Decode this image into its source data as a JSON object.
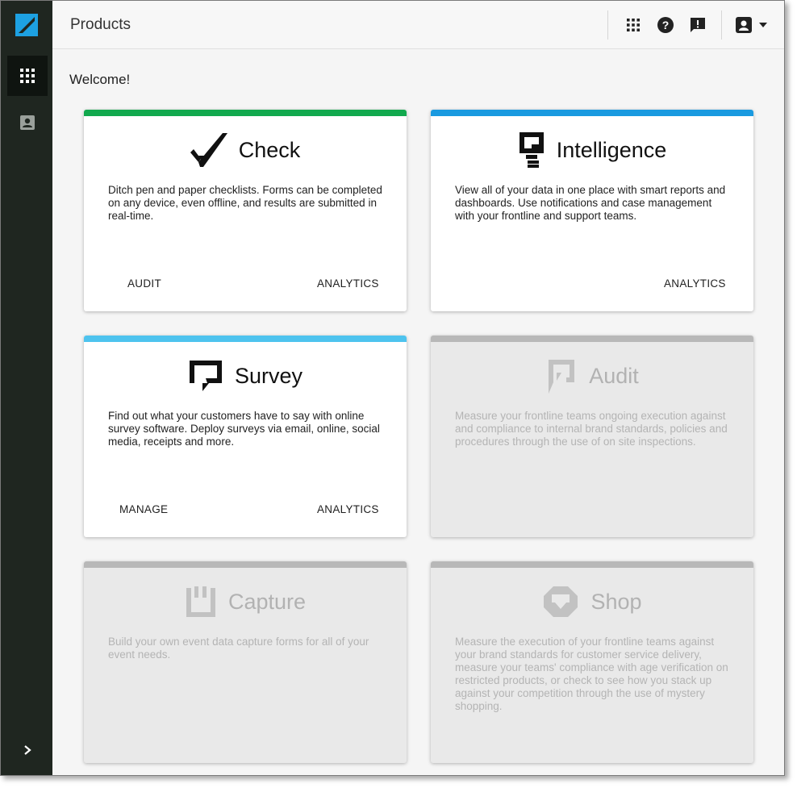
{
  "header": {
    "title": "Products"
  },
  "welcome": "Welcome!",
  "sidebar": {
    "items": [
      {
        "icon": "apps-grid-icon",
        "active": true
      },
      {
        "icon": "contact-card-icon",
        "active": false
      }
    ],
    "expand_icon": "chevron-right-icon"
  },
  "header_icons": [
    "apps-grid-icon",
    "help-icon",
    "feedback-icon",
    "account-icon",
    "caret-down-icon"
  ],
  "products": [
    {
      "name": "Check",
      "accent": "#12a94e",
      "icon": "check-logo-icon",
      "enabled": true,
      "description": "Ditch pen and paper checklists. Forms can be completed on any device, even offline, and results are submitted in real-time.",
      "actions": [
        "AUDIT",
        "ANALYTICS"
      ]
    },
    {
      "name": "Intelligence",
      "accent": "#1a9ae0",
      "icon": "intelligence-logo-icon",
      "enabled": true,
      "description": "View all of your data in one place with smart reports and dashboards. Use notifications and case management with your frontline and support teams.",
      "actions": [
        "ANALYTICS"
      ]
    },
    {
      "name": "Survey",
      "accent": "#4ec3ee",
      "icon": "survey-logo-icon",
      "enabled": true,
      "description": "Find out what your customers have to say with online survey software. Deploy surveys via email, online, social media, receipts and more.",
      "actions": [
        "MANAGE",
        "ANALYTICS"
      ]
    },
    {
      "name": "Audit",
      "accent": "#b8b8b8",
      "icon": "audit-logo-icon",
      "enabled": false,
      "description": "Measure your frontline teams ongoing execution against and compliance to internal brand standards, policies and procedures through the use of on site inspections.",
      "actions": []
    },
    {
      "name": "Capture",
      "accent": "#b8b8b8",
      "icon": "capture-logo-icon",
      "enabled": false,
      "description": "Build your own event data capture forms for all of your event needs.",
      "actions": []
    },
    {
      "name": "Shop",
      "accent": "#b8b8b8",
      "icon": "shop-logo-icon",
      "enabled": false,
      "description": "Measure the execution of your frontline teams against your brand standards for customer service delivery, measure your teams' compliance with age verification on restricted products, or check to see how you stack up against your competition through the use of mystery shopping.",
      "actions": []
    }
  ]
}
